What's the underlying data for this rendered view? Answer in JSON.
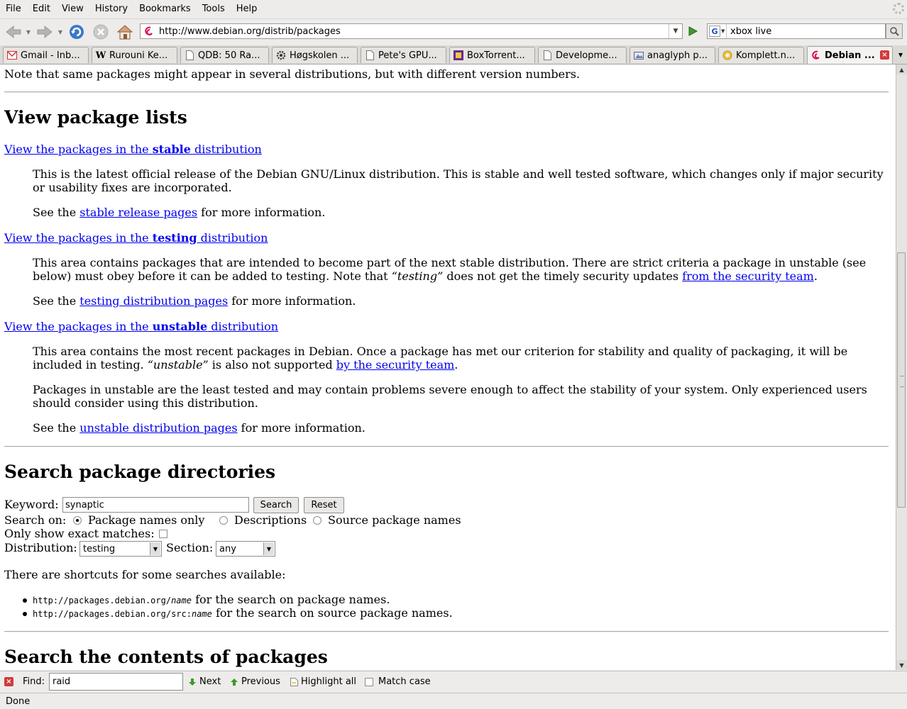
{
  "menubar": [
    "File",
    "Edit",
    "View",
    "History",
    "Bookmarks",
    "Tools",
    "Help"
  ],
  "navbar": {
    "url": "http://www.debian.org/distrib/packages",
    "search_query": "xbox live",
    "search_engine": "G"
  },
  "tabs": [
    {
      "label": "Gmail - Inb...",
      "icon": "gmail-icon"
    },
    {
      "label": "Rurouni Ke...",
      "icon": "wikipedia-icon"
    },
    {
      "label": "QDB: 50 Ra...",
      "icon": "page-icon"
    },
    {
      "label": "Høgskolen ...",
      "icon": "gear-icon"
    },
    {
      "label": "Pete's GPU...",
      "icon": "page-icon"
    },
    {
      "label": "BoxTorrent...",
      "icon": "boxtorrent-icon"
    },
    {
      "label": "Developme...",
      "icon": "page-icon"
    },
    {
      "label": "anaglyph p...",
      "icon": "image-icon"
    },
    {
      "label": "Komplett.n...",
      "icon": "komplett-icon"
    },
    {
      "label": "Debian ...",
      "icon": "debian-icon",
      "active": true
    }
  ],
  "content": {
    "intro": "Note that same packages might appear in several distributions, but with different version numbers.",
    "view_heading": "View package lists",
    "stable": {
      "link_pre": "View the packages in the ",
      "link_bold": "stable",
      "link_post": " distribution",
      "desc": "This is the latest official release of the Debian GNU/Linux distribution. This is stable and well tested software, which changes only if major security or usability fixes are incorporated.",
      "see_pre": "See the ",
      "see_link": "stable release pages",
      "see_post": " for more information."
    },
    "testing": {
      "link_pre": "View the packages in the ",
      "link_bold": "testing",
      "link_post": " distribution",
      "desc_1": "This area contains packages that are intended to become part of the next stable distribution. There are strict criteria a package in unstable (see below) must obey before it can be added to testing. Note that ",
      "desc_em": "“testing”",
      "desc_2": " does not get the timely security updates ",
      "desc_link": "from the security team",
      "desc_3": ".",
      "see_pre": "See the ",
      "see_link": "testing distribution pages",
      "see_post": " for more information."
    },
    "unstable": {
      "link_pre": "View the packages in the ",
      "link_bold": "unstable",
      "link_post": " distribution",
      "desc_1": "This area contains the most recent packages in Debian. Once a package has met our criterion for stability and quality of packaging, it will be included in testing. ",
      "desc_em": "“unstable”",
      "desc_2": " is also not supported ",
      "desc_link": "by the security team",
      "desc_3": ".",
      "warn": "Packages in unstable are the least tested and may contain problems severe enough to affect the stability of your system. Only experienced users should consider using this distribution.",
      "see_pre": "See the ",
      "see_link": "unstable distribution pages",
      "see_post": " for more information."
    },
    "search_heading": "Search package directories",
    "form": {
      "keyword_label": "Keyword:",
      "keyword_value": "synaptic",
      "search_btn": "Search",
      "reset_btn": "Reset",
      "search_on_label": "Search on:",
      "opt_names": "Package names only",
      "opt_desc": "Descriptions",
      "opt_source": "Source package names",
      "exact_label": "Only show exact matches:",
      "dist_label": "Distribution:",
      "dist_value": "testing",
      "section_label": "Section:",
      "section_value": "any"
    },
    "shortcuts_intro": "There are shortcuts for some searches available:",
    "shortcut_1_url": "http://packages.debian.org/",
    "shortcut_1_var": "name",
    "shortcut_1_text": " for the search on package names.",
    "shortcut_2_url": "http://packages.debian.org/src:",
    "shortcut_2_var": "name",
    "shortcut_2_text": " for the search on source package names.",
    "contents_heading": "Search the contents of packages"
  },
  "findbar": {
    "label": "Find:",
    "value": "raid",
    "next": "Next",
    "previous": "Previous",
    "highlight": "Highlight all",
    "match_case": "Match case"
  },
  "status": "Done"
}
